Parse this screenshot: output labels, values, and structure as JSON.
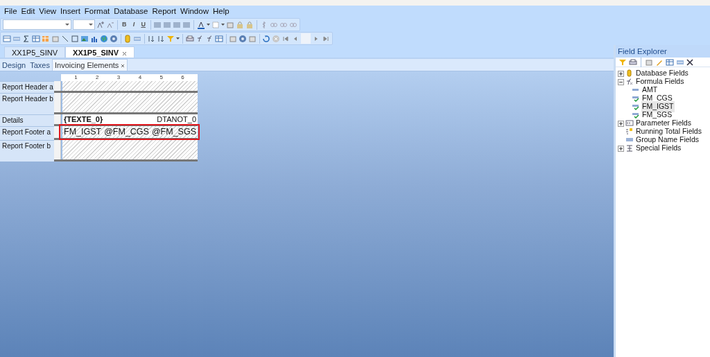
{
  "menu": [
    {
      "label": "File"
    },
    {
      "label": "Edit"
    },
    {
      "label": "View"
    },
    {
      "label": "Insert"
    },
    {
      "label": "Format"
    },
    {
      "label": "Database"
    },
    {
      "label": "Report"
    },
    {
      "label": "Window"
    },
    {
      "label": "Help"
    }
  ],
  "format_buttons": [
    {
      "label": "B"
    },
    {
      "label": "I"
    },
    {
      "label": "U"
    }
  ],
  "doc_tabs": [
    {
      "label": "XX1P5_SINV",
      "selected": false
    },
    {
      "label": "XX1P5_SINV",
      "selected": true
    }
  ],
  "view_tabs": [
    {
      "label": "Design",
      "selected": false
    },
    {
      "label": "Taxes",
      "selected": false
    },
    {
      "label": "Invoicing Elements",
      "selected": true
    }
  ],
  "ruler_marks": [
    "1",
    "2",
    "3",
    "4",
    "5",
    "6"
  ],
  "sections": [
    {
      "label": "Report Header a",
      "highlighted": false
    },
    {
      "label": "Report Header b",
      "highlighted": false
    },
    {
      "label": "Details",
      "fields": [
        {
          "text": "{TEXTE_0}",
          "bold": true
        },
        {
          "text": "DTANOT_0",
          "bold": false
        }
      ],
      "highlighted": false
    },
    {
      "label": "Report Footer a",
      "fields": [
        {
          "text": "FM_IGST",
          "bold": false
        },
        {
          "text": "@FM_CGS",
          "bold": false
        },
        {
          "text": "@FM_SGS",
          "bold": false
        }
      ],
      "highlighted": true
    },
    {
      "label": "Report Footer b",
      "highlighted": false
    }
  ],
  "field_explorer": {
    "title": "Field Explorer",
    "tree": [
      {
        "label": "Database Fields",
        "kind": "database",
        "expanded": false,
        "selected": false
      },
      {
        "label": "Formula Fields",
        "kind": "formula",
        "expanded": true,
        "selected": false,
        "children": [
          {
            "label": "AMT",
            "kind": "unused_formula",
            "selected": false
          },
          {
            "label": "FM_CGS",
            "kind": "used_formula",
            "selected": false
          },
          {
            "label": "FM_IGST",
            "kind": "used_formula",
            "selected": true
          },
          {
            "label": "FM_SGS",
            "kind": "used_formula",
            "selected": false
          }
        ]
      },
      {
        "label": "Parameter Fields",
        "kind": "parameter",
        "expanded": false,
        "selected": false
      },
      {
        "label": "Running Total Fields",
        "kind": "running_total",
        "selected": false
      },
      {
        "label": "Group Name Fields",
        "kind": "group_name",
        "selected": false
      },
      {
        "label": "Special Fields",
        "kind": "special",
        "expanded": false,
        "selected": false
      }
    ]
  }
}
